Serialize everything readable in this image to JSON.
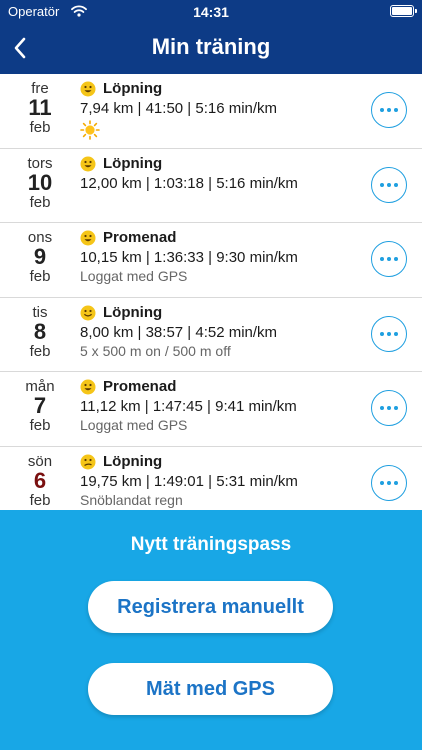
{
  "status_bar": {
    "carrier": "Operatör",
    "time": "14:31"
  },
  "header": {
    "title": "Min träning"
  },
  "entries": [
    {
      "dow": "fre",
      "day": "11",
      "month": "feb",
      "mood": "happy",
      "activity": "Löpning",
      "stats": "7,94 km | 41:50 | 5:16 min/km",
      "note": "",
      "weather": "sun-icon"
    },
    {
      "dow": "tors",
      "day": "10",
      "month": "feb",
      "mood": "happy",
      "activity": "Löpning",
      "stats": "12,00 km | 1:03:18 | 5:16 min/km",
      "note": ""
    },
    {
      "dow": "ons",
      "day": "9",
      "month": "feb",
      "mood": "happy",
      "activity": "Promenad",
      "stats": "10,15 km | 1:36:33 | 9:30 min/km",
      "note": "Loggat med GPS"
    },
    {
      "dow": "tis",
      "day": "8",
      "month": "feb",
      "mood": "smile",
      "activity": "Löpning",
      "stats": "8,00 km | 38:57 | 4:52 min/km",
      "note": "5 x 500 m on / 500 m off"
    },
    {
      "dow": "mån",
      "day": "7",
      "month": "feb",
      "mood": "happy",
      "activity": "Promenad",
      "stats": "11,12 km | 1:47:45 | 9:41 min/km",
      "note": "Loggat med GPS"
    },
    {
      "dow": "sön",
      "day": "6",
      "month": "feb",
      "mood": "confused",
      "activity": "Löpning",
      "stats": "19,75 km | 1:49:01 | 5:31 min/km",
      "note": "Snöblandat regn"
    }
  ],
  "new_session": {
    "title": "Nytt träningspass",
    "manual_label": "Registrera manuellt",
    "gps_label": "Mät med GPS"
  },
  "colors": {
    "header_bg": "#0d3b86",
    "panel_bg": "#18a7e6",
    "accent": "#1f9fe0",
    "button_text": "#1c74c6",
    "sunday": "#7a1010"
  }
}
